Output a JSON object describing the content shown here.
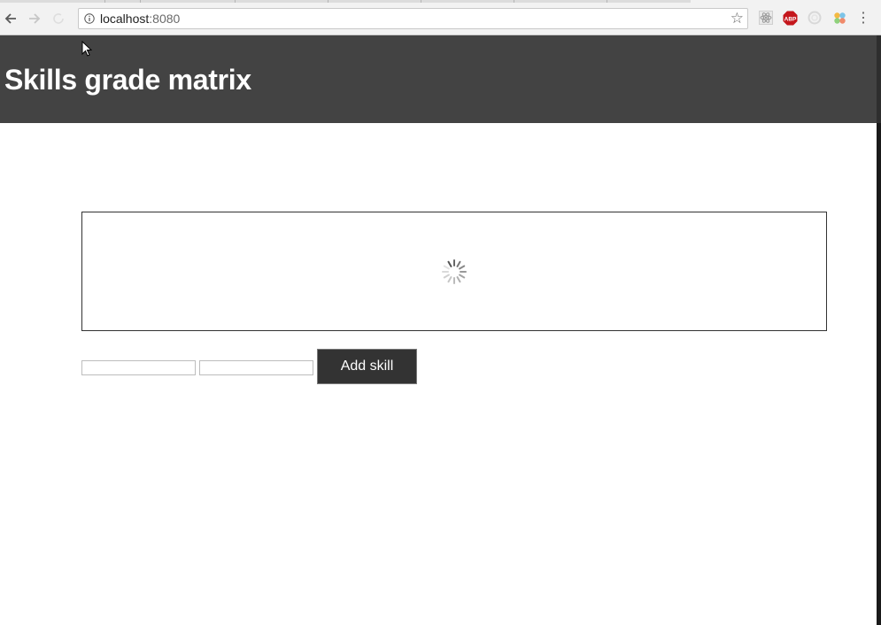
{
  "browser": {
    "url_host": "localhost",
    "url_port": ":8080",
    "extensions": [
      "react-devtools-icon",
      "adblock-icon",
      "refresh-circle-icon",
      "pinwheel-icon"
    ],
    "adblock_label": "ABP"
  },
  "app": {
    "title": "Skills grade matrix"
  },
  "matrix": {
    "state": "loading"
  },
  "form": {
    "input1_value": "",
    "input2_value": "",
    "add_button_label": "Add skill"
  },
  "colors": {
    "header_bg": "#434343",
    "button_bg": "#333333",
    "adblock_red": "#c4161c"
  }
}
